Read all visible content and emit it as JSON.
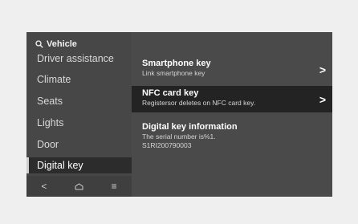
{
  "search": {
    "label": "Vehicle",
    "icon": "search-icon"
  },
  "sidebar": {
    "items": [
      {
        "label": "Driver assistance",
        "selected": false
      },
      {
        "label": "Climate",
        "selected": false
      },
      {
        "label": "Seats",
        "selected": false
      },
      {
        "label": "Lights",
        "selected": false
      },
      {
        "label": "Door",
        "selected": false
      },
      {
        "label": "Digital key",
        "selected": true
      }
    ]
  },
  "bottom_nav": {
    "back": "<",
    "home_icon": "home-icon",
    "menu": "≡"
  },
  "content": {
    "rows": [
      {
        "title": "Smartphone key",
        "subtitle": "Link smartphone key",
        "chevron": ">"
      },
      {
        "title": "NFC card key",
        "subtitle": "Registersor deletes on NFC card key.",
        "chevron": ">"
      },
      {
        "title": "Digital key information",
        "subtitle_line1": "The serial number is%1.",
        "subtitle_line2": "S1RI200790003"
      }
    ]
  },
  "colors": {
    "background": "#4a4a4a",
    "selected": "#2c2c2c",
    "highlight": "#232323"
  }
}
